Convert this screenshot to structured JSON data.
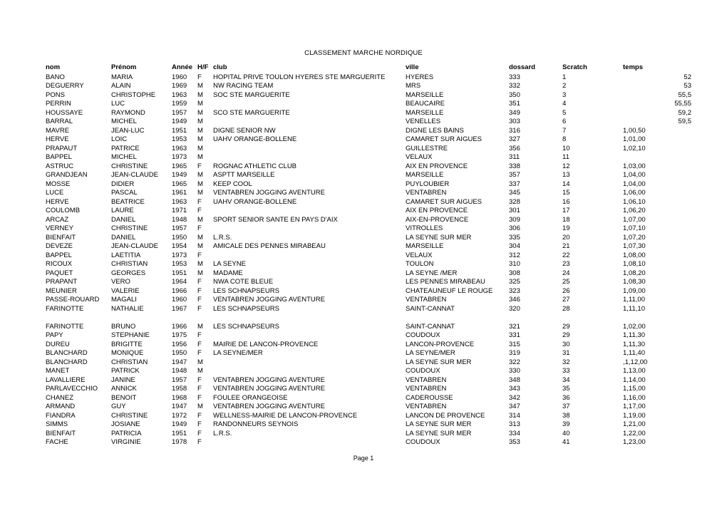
{
  "document": {
    "title": "CLASSEMENT MARCHE NORDIQUE",
    "footer": "Page 1"
  },
  "table": {
    "columns": [
      {
        "key": "nom",
        "label": "nom"
      },
      {
        "key": "prenom",
        "label": "Prénom"
      },
      {
        "key": "annee",
        "label": "Année"
      },
      {
        "key": "hf",
        "label": "H/F"
      },
      {
        "key": "club",
        "label": "club"
      },
      {
        "key": "ville",
        "label": "ville"
      },
      {
        "key": "dossard",
        "label": "dossard"
      },
      {
        "key": "scratch",
        "label": "Scratch"
      },
      {
        "key": "temps",
        "label": "temps"
      }
    ],
    "rows": [
      {
        "nom": "BANO",
        "prenom": "MARIA",
        "annee": "1960",
        "hf": "F",
        "club": "HOPITAL PRIVE TOULON HYERES STE MARGUERITE",
        "ville": "HYERES",
        "dossard": "333",
        "scratch": "1",
        "temps": "52",
        "temps_numeric": true
      },
      {
        "nom": "DEGUERRY",
        "prenom": "ALAIN",
        "annee": "1969",
        "hf": "M",
        "club": "NW RACING TEAM",
        "ville": "MRS",
        "dossard": "332",
        "scratch": "2",
        "temps": "53",
        "temps_numeric": true
      },
      {
        "nom": "PONS",
        "prenom": "CHRISTOPHE",
        "annee": "1963",
        "hf": "M",
        "club": "SOC STE MARGUERITE",
        "ville": "MARSEILLE",
        "dossard": "350",
        "scratch": "3",
        "temps": "55,5",
        "temps_numeric": true
      },
      {
        "nom": "PERRIN",
        "prenom": "LUC",
        "annee": "1959",
        "hf": "M",
        "club": "",
        "ville": "BEAUCAIRE",
        "dossard": "351",
        "scratch": "4",
        "temps": "55,55",
        "temps_numeric": true
      },
      {
        "nom": "HOUSSAYE",
        "prenom": "RAYMOND",
        "annee": "1957",
        "hf": "M",
        "club": "SCO STE MARGUERITE",
        "ville": "MARSEILLE",
        "dossard": "349",
        "scratch": "5",
        "temps": "59,2",
        "temps_numeric": true
      },
      {
        "nom": "BARRAL",
        "prenom": "MICHEL",
        "annee": "1949",
        "hf": "M",
        "club": "",
        "ville": "VENELLES",
        "dossard": "303",
        "scratch": "6",
        "temps": "59,5",
        "temps_numeric": true
      },
      {
        "nom": "MAVRE",
        "prenom": "JEAN-LUC",
        "annee": "1951",
        "hf": "M",
        "club": "DIGNE SENIOR NW",
        "ville": "DIGNE LES BAINS",
        "dossard": "316",
        "scratch": "7",
        "temps": "1,00,50",
        "temps_numeric": false
      },
      {
        "nom": "HERVE",
        "prenom": "LOIC",
        "annee": "1953",
        "hf": "M",
        "club": "UAHV ORANGE-BOLLENE",
        "ville": "CAMARET SUR AIGUES",
        "dossard": "327",
        "scratch": "8",
        "temps": "1,01,00",
        "temps_numeric": false
      },
      {
        "nom": "PRAPAUT",
        "prenom": "PATRICE",
        "annee": "1963",
        "hf": "M",
        "club": "",
        "ville": "GUILLESTRE",
        "dossard": "356",
        "scratch": "10",
        "temps": "1,02,10",
        "temps_numeric": false
      },
      {
        "nom": "BAPPEL",
        "prenom": "MICHEL",
        "annee": "1973",
        "hf": "M",
        "club": "",
        "ville": "VELAUX",
        "dossard": "311",
        "scratch": "11",
        "temps": "",
        "temps_numeric": false
      },
      {
        "nom": "ASTRUC",
        "prenom": "CHRISTINE",
        "annee": "1965",
        "hf": "F",
        "club": "ROGNAC ATHLETIC CLUB",
        "ville": "AIX EN PROVENCE",
        "dossard": "338",
        "scratch": "12",
        "temps": "1,03,00",
        "temps_numeric": false
      },
      {
        "nom": "GRANDJEAN",
        "prenom": "JEAN-CLAUDE",
        "annee": "1949",
        "hf": "M",
        "club": "ASPTT MARSEILLE",
        "ville": "MARSEILLE",
        "dossard": "357",
        "scratch": "13",
        "temps": "1,04,00",
        "temps_numeric": false
      },
      {
        "nom": "MOSSE",
        "prenom": "DIDIER",
        "annee": "1965",
        "hf": "M",
        "club": "KEEP COOL",
        "ville": "PUYLOUBIER",
        "dossard": "337",
        "scratch": "14",
        "temps": "1,04,00",
        "temps_numeric": false
      },
      {
        "nom": "LUCE",
        "prenom": "PASCAL",
        "annee": "1961",
        "hf": "M",
        "club": "VENTABREN JOGGING AVENTURE",
        "ville": "VENTABREN",
        "dossard": "345",
        "scratch": "15",
        "temps": "1,06,00",
        "temps_numeric": false
      },
      {
        "nom": "HERVE",
        "prenom": "BEATRICE",
        "annee": "1963",
        "hf": "F",
        "club": "UAHV ORANGE-BOLLENE",
        "ville": "CAMARET SUR AIGUES",
        "dossard": "328",
        "scratch": "16",
        "temps": "1,06,10",
        "temps_numeric": false
      },
      {
        "nom": "COULOMB",
        "prenom": "LAURE",
        "annee": "1971",
        "hf": "F",
        "club": "",
        "ville": "AIX EN PROVENCE",
        "dossard": "301",
        "scratch": "17",
        "temps": "1,06,20",
        "temps_numeric": false
      },
      {
        "nom": "ARCAZ",
        "prenom": "DANIEL",
        "annee": "1948",
        "hf": "M",
        "club": "SPORT SENIOR SANTE EN PAYS D'AIX",
        "ville": "AIX-EN-PROVENCE",
        "dossard": "309",
        "scratch": "18",
        "temps": "1,07,00",
        "temps_numeric": false
      },
      {
        "nom": "VERNEY",
        "prenom": "CHRISTINE",
        "annee": "1957",
        "hf": "F",
        "club": "",
        "ville": "VITROLLES",
        "dossard": "306",
        "scratch": "19",
        "temps": "1,07,10",
        "temps_numeric": false
      },
      {
        "nom": "BIENFAIT",
        "prenom": "DANIEL",
        "annee": "1950",
        "hf": "M",
        "club": "L.R.S.",
        "ville": "LA SEYNE SUR MER",
        "dossard": "335",
        "scratch": "20",
        "temps": "1,07,20",
        "temps_numeric": false
      },
      {
        "nom": "DEVEZE",
        "prenom": "JEAN-CLAUDE",
        "annee": "1954",
        "hf": "M",
        "club": "AMICALE DES PENNES MIRABEAU",
        "ville": "MARSEILLE",
        "dossard": "304",
        "scratch": "21",
        "temps": "1,07,30",
        "temps_numeric": false
      },
      {
        "nom": "BAPPEL",
        "prenom": "LAETITIA",
        "annee": "1973",
        "hf": "F",
        "club": "",
        "ville": "VELAUX",
        "dossard": "312",
        "scratch": "22",
        "temps": "1,08,00",
        "temps_numeric": false
      },
      {
        "nom": "RICOUX",
        "prenom": "CHRISTIAN",
        "annee": "1953",
        "hf": "M",
        "club": "LA SEYNE",
        "ville": "TOULON",
        "dossard": "310",
        "scratch": "23",
        "temps": "1,08,10",
        "temps_numeric": false
      },
      {
        "nom": "PAQUET",
        "prenom": "GEORGES",
        "annee": "1951",
        "hf": "M",
        "club": "MADAME",
        "ville": "LA SEYNE /MER",
        "dossard": "308",
        "scratch": "24",
        "temps": "1,08,20",
        "temps_numeric": false
      },
      {
        "nom": "PRAPANT",
        "prenom": "VERO",
        "annee": "1964",
        "hf": "F",
        "club": "NWA COTE BLEUE",
        "ville": "LES PENNES MIRABEAU",
        "dossard": "325",
        "scratch": "25",
        "temps": "1,08,30",
        "temps_numeric": false
      },
      {
        "nom": "MEUNIER",
        "prenom": "VALERIE",
        "annee": "1966",
        "hf": "F",
        "club": "LES SCHNAPSEURS",
        "ville": "CHATEAUNEUF LE ROUGE",
        "dossard": "323",
        "scratch": "26",
        "temps": "1,09,00",
        "temps_numeric": false
      },
      {
        "nom": "PASSE-ROUARD",
        "prenom": "MAGALI",
        "annee": "1960",
        "hf": "F",
        "club": "VENTABREN JOGGING AVENTURE",
        "ville": "VENTABREN",
        "dossard": "346",
        "scratch": "27",
        "temps": "1,11,00",
        "temps_numeric": false
      },
      {
        "nom": "FARINOTTE",
        "prenom": "NATHALIE",
        "annee": "1967",
        "hf": "F",
        "club": "LES SCHNAPSEURS",
        "ville": "SAINT-CANNAT",
        "dossard": "320",
        "scratch": "28",
        "temps": "1,11,10",
        "temps_numeric": false
      },
      {
        "spacer": true
      },
      {
        "nom": "FARINOTTE",
        "prenom": "BRUNO",
        "annee": "1966",
        "hf": "M",
        "club": "LES SCHNAPSEURS",
        "ville": "SAINT-CANNAT",
        "dossard": "321",
        "scratch": "29",
        "temps": "1,02,00",
        "temps_numeric": false
      },
      {
        "nom": "PAPY",
        "prenom": "STEPHANIE",
        "annee": "1975",
        "hf": "F",
        "club": "",
        "ville": "COUDOUX",
        "dossard": "331",
        "scratch": "29",
        "temps": "1,11,30",
        "temps_numeric": false
      },
      {
        "nom": "DUREU",
        "prenom": "BRIGITTE",
        "annee": "1956",
        "hf": "F",
        "club": "MAIRIE DE LANCON-PROVENCE",
        "ville": "LANCON-PROVENCE",
        "dossard": "315",
        "scratch": "30",
        "temps": "1,11,30",
        "temps_numeric": false
      },
      {
        "nom": "BLANCHARD",
        "prenom": "MONIQUE",
        "annee": "1950",
        "hf": "F",
        "club": "LA SEYNE/MER",
        "ville": "LA SEYNE/MER",
        "dossard": "319",
        "scratch": "31",
        "temps": "1,11,40",
        "temps_numeric": false
      },
      {
        "nom": "BLANCHARD",
        "prenom": "CHRISTIAN",
        "annee": "1947",
        "hf": "M",
        "club": "",
        "ville": "LA SEYNE SUR MER",
        "dossard": "322",
        "scratch": "32",
        "temps": ",1,12,00",
        "temps_numeric": false
      },
      {
        "nom": "MANET",
        "prenom": "PATRICK",
        "annee": "1948",
        "hf": "M",
        "club": "",
        "ville": "COUDOUX",
        "dossard": "330",
        "scratch": "33",
        "temps": "1,13,00",
        "temps_numeric": false
      },
      {
        "nom": "LAVALLIERE",
        "prenom": "JANINE",
        "annee": "1957",
        "hf": "F",
        "club": "VENTABREN JOGGING AVENTURE",
        "ville": "VENTABREN",
        "dossard": "348",
        "scratch": "34",
        "temps": "1,14,00",
        "temps_numeric": false
      },
      {
        "nom": "PARLAVECCHIO",
        "prenom": "ANNICK",
        "annee": "1958",
        "hf": "F",
        "club": "VENTABREN JOGGING AVENTURE",
        "ville": "VENTABREN",
        "dossard": "343",
        "scratch": "35",
        "temps": "1,15,00",
        "temps_numeric": false
      },
      {
        "nom": "CHANEZ",
        "prenom": "BENOIT",
        "annee": "1968",
        "hf": "F",
        "club": "FOULEE ORANGEOISE",
        "ville": "CADEROUSSE",
        "dossard": "342",
        "scratch": "36",
        "temps": "1,16,00",
        "temps_numeric": false
      },
      {
        "nom": "ARMAND",
        "prenom": "GUY",
        "annee": "1947",
        "hf": "M",
        "club": "VENTABREN JOGGING AVENTURE",
        "ville": "VENTABREN",
        "dossard": "347",
        "scratch": "37",
        "temps": "1,17,00",
        "temps_numeric": false
      },
      {
        "nom": "FIANDRA",
        "prenom": "CHRISTINE",
        "annee": "1972",
        "hf": "F",
        "club": "WELLNESS-MAIRIE DE LANCON-PROVENCE",
        "ville": "LANCON DE PROVENCE",
        "dossard": "314",
        "scratch": "38",
        "temps": "1,19,00",
        "temps_numeric": false
      },
      {
        "nom": "SIMMS",
        "prenom": "JOSIANE",
        "annee": "1949",
        "hf": "F",
        "club": "RANDONNEURS SEYNOIS",
        "ville": "LA SEYNE SUR MER",
        "dossard": "313",
        "scratch": "39",
        "temps": "1,21,00",
        "temps_numeric": false
      },
      {
        "nom": "BIENFAIT",
        "prenom": "PATRICIA",
        "annee": "1951",
        "hf": "F",
        "club": "L.R.S.",
        "ville": "LA SEYNE SUR MER",
        "dossard": "334",
        "scratch": "40",
        "temps": "1,22,00",
        "temps_numeric": false
      },
      {
        "nom": "FACHE",
        "prenom": "VIRGINIE",
        "annee": "1978",
        "hf": "F",
        "club": "",
        "ville": "COUDOUX",
        "dossard": "353",
        "scratch": "41",
        "temps": "1,23,00",
        "temps_numeric": false
      }
    ]
  }
}
